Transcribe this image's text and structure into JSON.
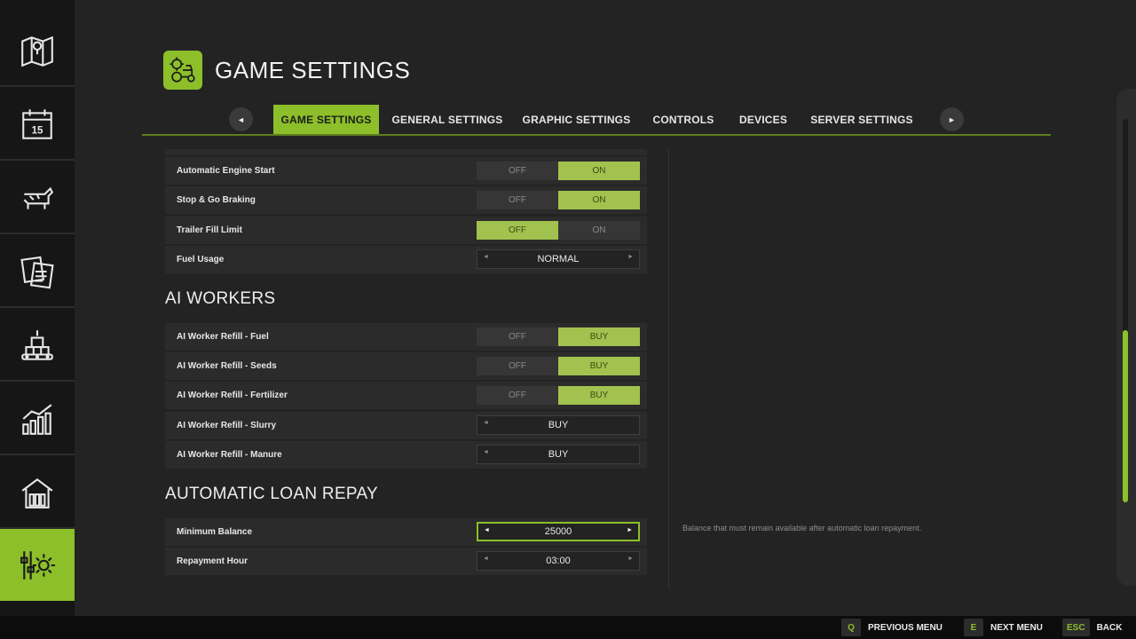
{
  "sidebar": {
    "items": [
      {
        "icon": "map-icon"
      },
      {
        "icon": "calendar-icon",
        "badge": "15"
      },
      {
        "icon": "animals-icon"
      },
      {
        "icon": "contracts-icon"
      },
      {
        "icon": "production-icon"
      },
      {
        "icon": "statistics-icon"
      },
      {
        "icon": "farm-buildings-icon"
      },
      {
        "icon": "settings-icon",
        "active": true
      }
    ]
  },
  "header": {
    "title": "GAME SETTINGS",
    "icon": "tractor-gear-icon"
  },
  "tabs": [
    {
      "label": "GAME SETTINGS",
      "active": true
    },
    {
      "label": "GENERAL SETTINGS"
    },
    {
      "label": "GRAPHIC SETTINGS"
    },
    {
      "label": "CONTROLS"
    },
    {
      "label": "DEVICES"
    },
    {
      "label": "SERVER SETTINGS"
    }
  ],
  "settings": {
    "rows": [
      {
        "label": "Automatic Engine Start",
        "off": "OFF",
        "on": "ON",
        "value": "ON"
      },
      {
        "label": "Stop & Go Braking",
        "off": "OFF",
        "on": "ON",
        "value": "ON"
      },
      {
        "label": "Trailer Fill Limit",
        "off": "OFF",
        "on": "ON",
        "value": "OFF"
      },
      {
        "label": "Fuel Usage",
        "value": "NORMAL"
      }
    ],
    "ai_workers": {
      "title": "AI WORKERS",
      "rows": [
        {
          "label": "AI Worker Refill - Fuel",
          "off": "OFF",
          "on": "BUY",
          "value": "BUY"
        },
        {
          "label": "AI Worker Refill - Seeds",
          "off": "OFF",
          "on": "BUY",
          "value": "BUY"
        },
        {
          "label": "AI Worker Refill - Fertilizer",
          "off": "OFF",
          "on": "BUY",
          "value": "BUY"
        },
        {
          "label": "AI Worker Refill - Slurry",
          "value": "BUY"
        },
        {
          "label": "AI Worker Refill - Manure",
          "value": "BUY"
        }
      ]
    },
    "loan": {
      "title": "AUTOMATIC LOAN REPAY",
      "rows": [
        {
          "label": "Minimum Balance",
          "value": "25000",
          "focused": true
        },
        {
          "label": "Repayment Hour",
          "value": "03:00"
        }
      ]
    }
  },
  "help_text": "Balance that must remain available after automatic loan repayment.",
  "bottom_hints": [
    {
      "key": "Q",
      "label": "PREVIOUS MENU"
    },
    {
      "key": "E",
      "label": "NEXT MENU"
    },
    {
      "key": "ESC",
      "label": "BACK"
    }
  ],
  "colors": {
    "accent": "#8cbf2a",
    "toggle_on": "#a2c24f",
    "background": "#232323",
    "row": "#2b2b2b"
  }
}
